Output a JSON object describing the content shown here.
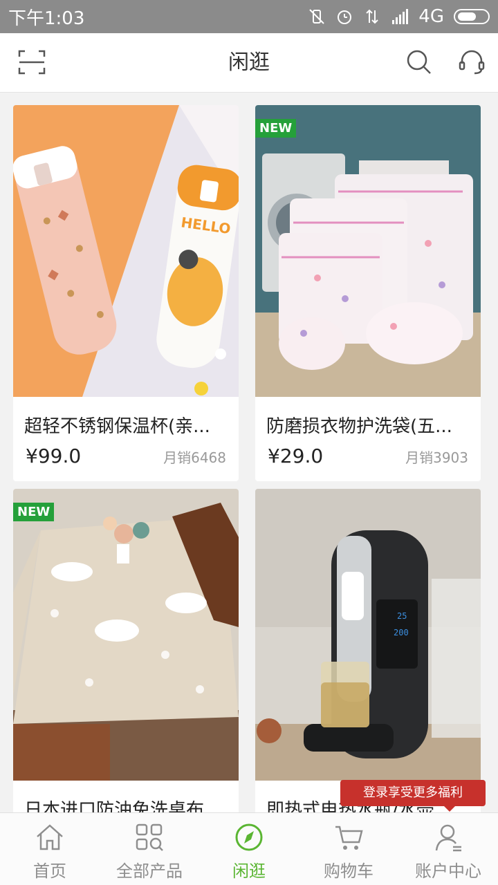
{
  "status_bar": {
    "time": "下午1:03",
    "network": "4G"
  },
  "header": {
    "title": "闲逛",
    "scan_icon": "scan-icon",
    "search_icon": "search-icon",
    "service_icon": "headset-icon"
  },
  "products": [
    {
      "name": "超轻不锈钢保温杯(亲...",
      "price": "¥99.0",
      "sales": "月销6468",
      "badge": ""
    },
    {
      "name": "防磨损衣物护洗袋(五...",
      "price": "¥29.0",
      "sales": "月销3903",
      "badge": "NEW"
    },
    {
      "name": "日本进口防油免洗桌布",
      "price": "",
      "sales": "",
      "badge": "NEW"
    },
    {
      "name": "即热式电热水瓶/水壶",
      "price": "",
      "sales": "",
      "badge": ""
    }
  ],
  "login_tip": "登录享受更多福利",
  "bottom_nav": {
    "items": [
      {
        "label": "首页",
        "icon": "home-icon",
        "active": false
      },
      {
        "label": "全部产品",
        "icon": "grid-search-icon",
        "active": false
      },
      {
        "label": "闲逛",
        "icon": "compass-icon",
        "active": true
      },
      {
        "label": "购物车",
        "icon": "cart-icon",
        "active": false
      },
      {
        "label": "账户中心",
        "icon": "user-icon",
        "active": false
      }
    ]
  },
  "colors": {
    "accent": "#5ab532",
    "badge": "#25a03a",
    "tip": "#c7312c",
    "statusbar": "#8b8b8b"
  }
}
